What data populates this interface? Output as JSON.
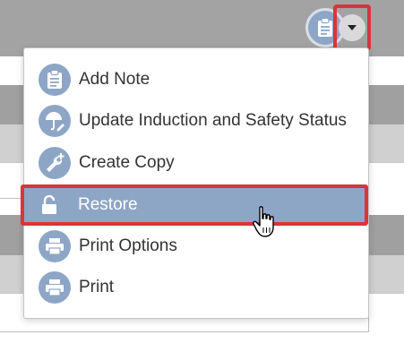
{
  "header": {
    "clipboard_button_icon": "clipboard-icon",
    "dropdown_toggle_icon": "caret-down-icon"
  },
  "menu": {
    "items": [
      {
        "label": "Add Note",
        "icon": "clipboard-note-icon"
      },
      {
        "label": "Update Induction and Safety Status",
        "icon": "umbrella-pencil-icon"
      },
      {
        "label": "Create Copy",
        "icon": "wrench-plus-icon"
      },
      {
        "label": "Restore",
        "icon": "unlock-icon",
        "highlighted": true
      },
      {
        "label": "Print Options",
        "icon": "printer-icon"
      },
      {
        "label": "Print",
        "icon": "printer-icon"
      }
    ]
  },
  "colors": {
    "header_bg": "#a3a3a3",
    "icon_circle": "#8ea6c6",
    "highlight_bg": "#8ea6c6",
    "highlight_border": "#d9343d",
    "text": "#333333"
  }
}
